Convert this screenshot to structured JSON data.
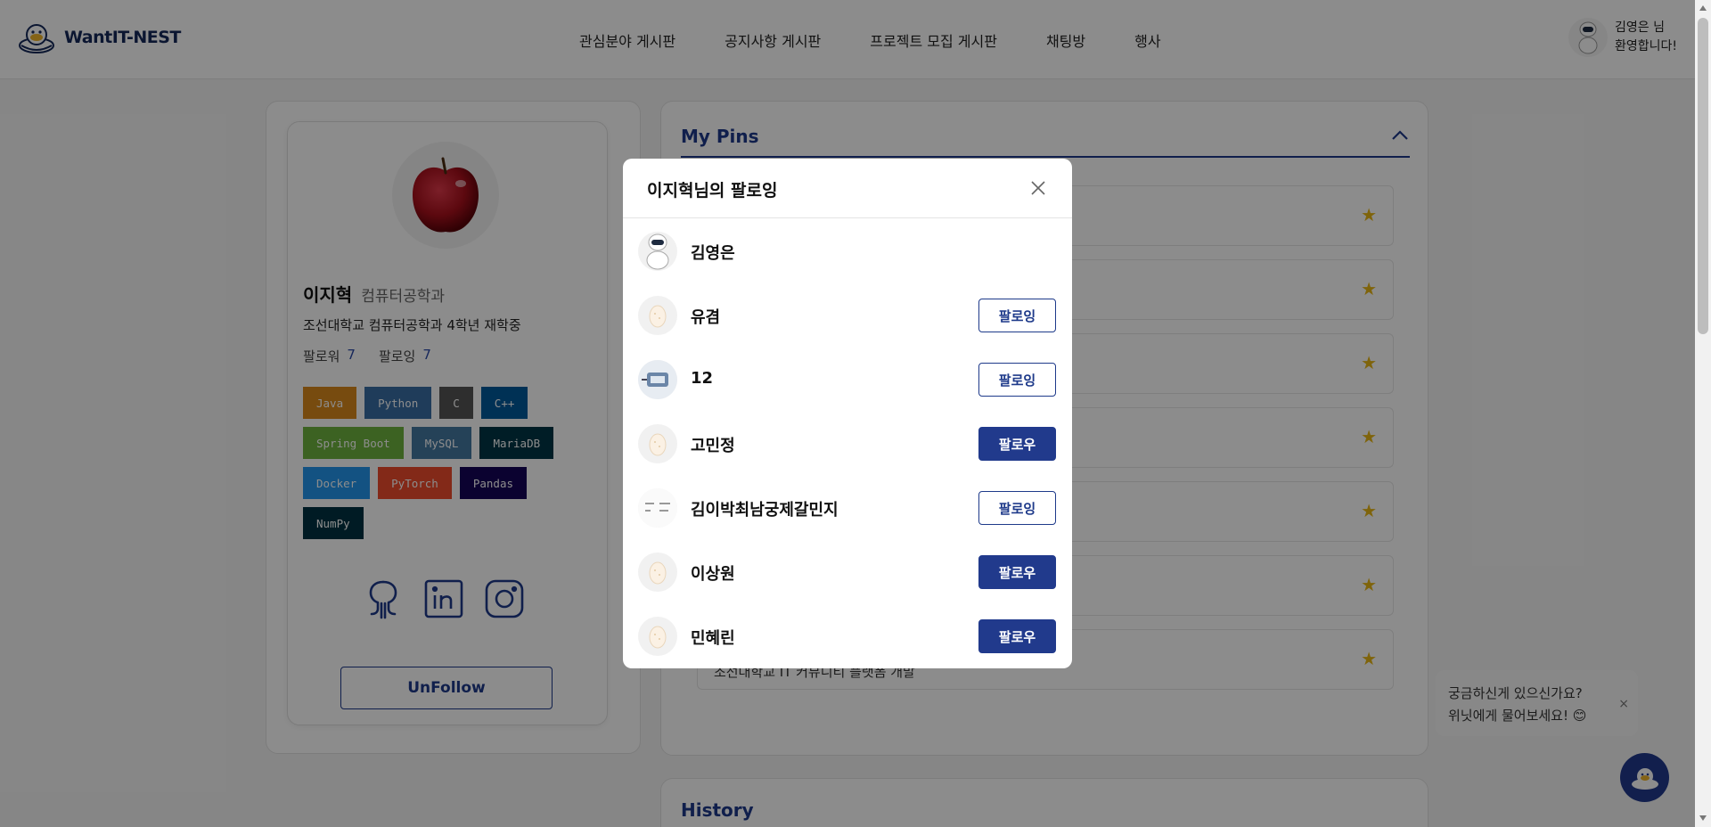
{
  "header": {
    "logo_text": "WantIT-NEST",
    "nav": [
      "관심분야 게시판",
      "공지사항 게시판",
      "프로젝트 모집 게시판",
      "채팅방",
      "행사"
    ],
    "user_greeting_line1": "김영은 님",
    "user_greeting_line2": "환영합니다!"
  },
  "profile": {
    "name": "이지혁",
    "department": "컴퓨터공학과",
    "school": "조선대학교 컴퓨터공학과 4학년 재학중",
    "followers_label": "팔로워",
    "followers_count": "7",
    "following_label": "팔로잉",
    "following_count": "7",
    "tags": [
      {
        "label": "Java",
        "color": "#d9891c"
      },
      {
        "label": "Python",
        "color": "#3a6ea5"
      },
      {
        "label": "C",
        "color": "#555555"
      },
      {
        "label": "C++",
        "color": "#00599c"
      },
      {
        "label": "Spring Boot",
        "color": "#6db33f"
      },
      {
        "label": "MySQL",
        "color": "#4479a1"
      },
      {
        "label": "MariaDB",
        "color": "#003545"
      },
      {
        "label": "Docker",
        "color": "#2496ed"
      },
      {
        "label": "PyTorch",
        "color": "#ee4c2c"
      },
      {
        "label": "Pandas",
        "color": "#150458"
      },
      {
        "label": "NumPy",
        "color": "#013243"
      }
    ],
    "socials": [
      "github-icon",
      "linkedin-icon",
      "instagram-icon"
    ],
    "unfollow_label": "UnFollow"
  },
  "pins": {
    "title": "My Pins",
    "visible_text": "조선대학교 IT 커뮤니티 플랫폼 개발"
  },
  "history": {
    "title": "History"
  },
  "modal": {
    "title": "이지혁님의 팔로잉",
    "users": [
      {
        "name": "김영은",
        "button": "",
        "state": "self",
        "avatar": "robot-avatar"
      },
      {
        "name": "유겸",
        "button": "팔로잉",
        "state": "following",
        "avatar": "egg-avatar"
      },
      {
        "name": "12",
        "button": "팔로잉",
        "state": "following",
        "avatar": "robot-photo-avatar"
      },
      {
        "name": "고민정",
        "button": "팔로우",
        "state": "follow",
        "avatar": "egg-avatar"
      },
      {
        "name": "김이박최남궁제갈민지",
        "button": "팔로잉",
        "state": "following",
        "avatar": "text-avatar"
      },
      {
        "name": "이상원",
        "button": "팔로우",
        "state": "follow",
        "avatar": "egg-avatar"
      },
      {
        "name": "민혜린",
        "button": "팔로우",
        "state": "follow",
        "avatar": "egg-avatar"
      }
    ]
  },
  "chat": {
    "tip_line1": "궁금하신게 있으신가요?",
    "tip_line2": "위닛에게 물어보세요! 😊",
    "close": "×"
  },
  "colors": {
    "brand": "#1e3a8a",
    "star": "#e8b614"
  }
}
